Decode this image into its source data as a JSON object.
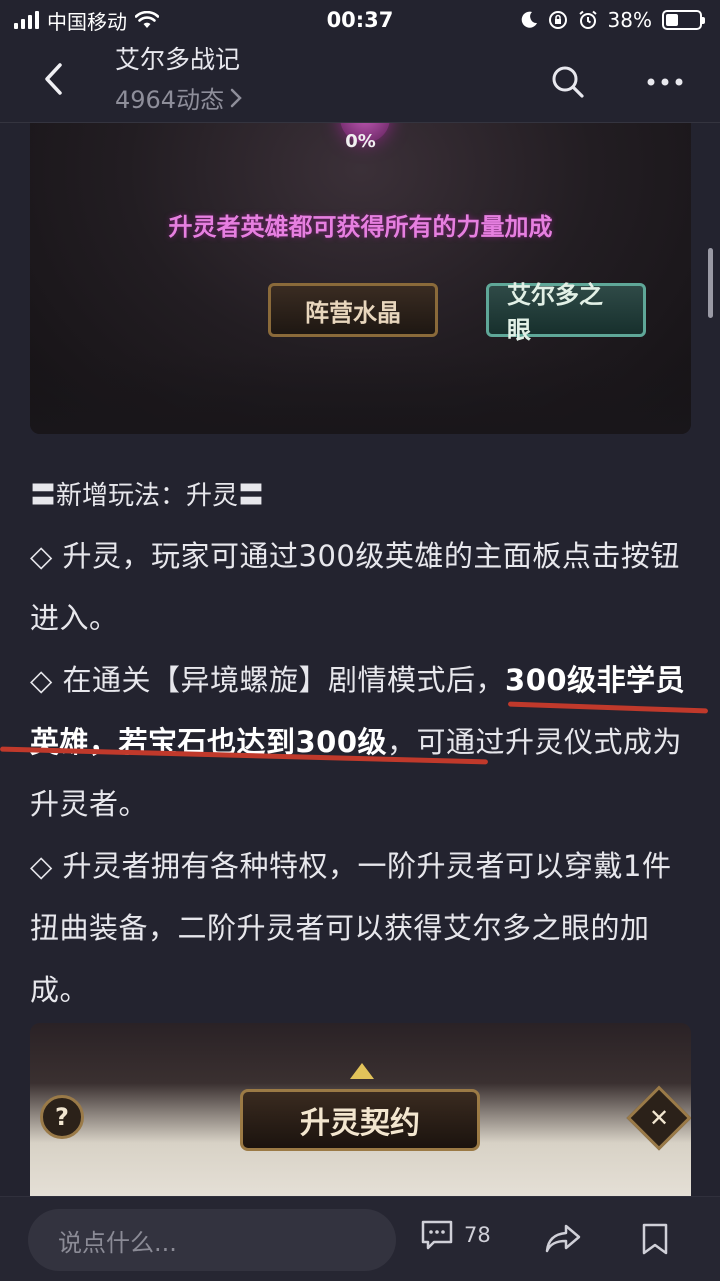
{
  "status_bar": {
    "carrier": "中国移动",
    "time": "00:37",
    "battery": "38%",
    "battery_level": 0.38
  },
  "header": {
    "title": "艾尔多战记",
    "subtitle": "4964动态",
    "back_icon": "chevron-left-icon",
    "search_icon": "search-icon",
    "more_icon": "more-icon"
  },
  "image1": {
    "percent": "0%",
    "caption": "升灵者英雄都可获得所有的力量加成",
    "button_left": "阵营水晶",
    "button_right": "艾尔多之眼"
  },
  "post": {
    "section_title": "〓新增玩法：升灵〓",
    "para1": "◇ 升灵，玩家可通过300级英雄的主面板点击按钮进入。",
    "para2_a": "◇ 在通关【异境螺旋】剧情模式后，",
    "para2_b": "300级非学员英雄，若宝石也达到300级",
    "para2_c": "，可通过升灵仪式成为升灵者。",
    "para3": "◇ 升灵者拥有各种特权，一阶升灵者可以穿戴1件扭曲装备，二阶升灵者可以获得艾尔多之眼的加成。"
  },
  "image2": {
    "title": "升灵契约",
    "help": "?",
    "close": "✕"
  },
  "bottom_bar": {
    "comment_placeholder": "说点什么...",
    "comment_count": "78",
    "comment_icon": "comment-icon",
    "share_icon": "share-icon",
    "bookmark_icon": "bookmark-icon"
  },
  "colors": {
    "background": "#23232f",
    "underline": "#c0392b",
    "caption_pink": "#e67fe0"
  }
}
